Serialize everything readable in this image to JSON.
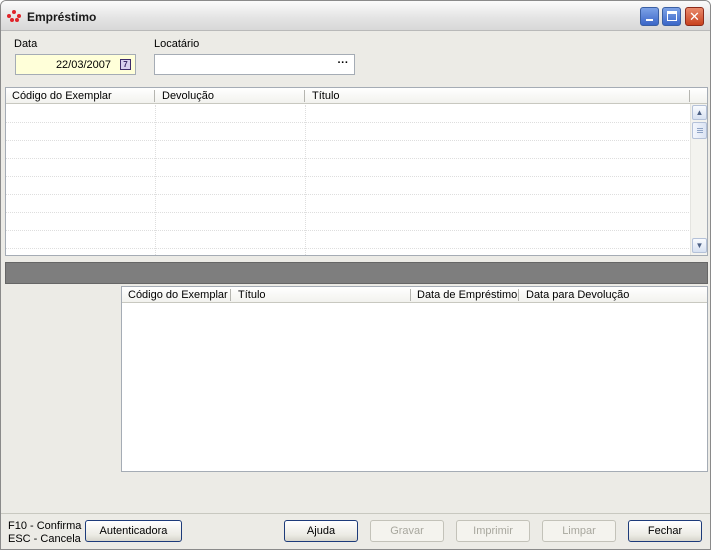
{
  "window": {
    "title": "Empréstimo"
  },
  "form": {
    "date_label": "Data",
    "date_value": "22/03/2007",
    "locatario_label": "Locatário",
    "locatario_value": "",
    "lookup_button": "···"
  },
  "top_grid": {
    "columns": [
      "Código do Exemplar",
      "Devolução",
      "Título"
    ],
    "rows": []
  },
  "bottom_grid": {
    "columns": [
      "Código do Exemplar",
      "Título",
      "Data de Empréstimo",
      "Data para Devolução"
    ],
    "rows": []
  },
  "footer": {
    "hint_confirm": "F10 - Confirma",
    "hint_cancel": "ESC - Cancela",
    "buttons": {
      "autenticadora": "Autenticadora",
      "ajuda": "Ajuda",
      "gravar": "Gravar",
      "imprimir": "Imprimir",
      "limpar": "Limpar",
      "fechar": "Fechar"
    }
  },
  "colors": {
    "date_field_bg": "#ffffd9",
    "splitter": "#7e7e7e",
    "close_button": "#c8421f"
  }
}
